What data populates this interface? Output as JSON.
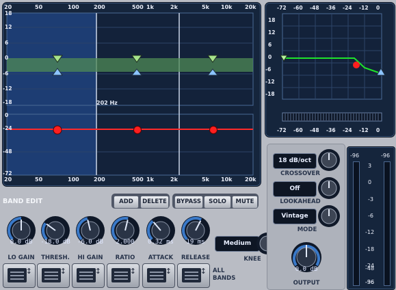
{
  "eq": {
    "freq_ticks": [
      "20",
      "50",
      "100",
      "200",
      "500",
      "1k",
      "2k",
      "5k",
      "10k",
      "20k"
    ],
    "gain_ticks_upper": [
      "18",
      "12",
      "6",
      "0",
      "-6",
      "-12",
      "-18"
    ],
    "gain_ticks_lower": [
      "0",
      "-24",
      "-48",
      "-72"
    ],
    "cursor_freq": "202 Hz"
  },
  "transfer": {
    "ticks_x": [
      "-72",
      "-60",
      "-48",
      "-36",
      "-24",
      "-12",
      "0"
    ],
    "ticks_y": [
      "18",
      "12",
      "6",
      "0",
      "-6",
      "-12",
      "-18"
    ]
  },
  "band_edit": {
    "title": "BAND EDIT",
    "add": "ADD",
    "delete": "DELETE",
    "bypass": "BYPASS",
    "solo": "SOLO",
    "mute": "MUTE"
  },
  "knobs": [
    {
      "label": "LO GAIN",
      "value": "0.0 dB"
    },
    {
      "label": "THRESH.",
      "value": "-18.0 dB"
    },
    {
      "label": "HI GAIN",
      "value": "-6.0 dB"
    },
    {
      "label": "RATIO",
      "value": "2.000"
    },
    {
      "label": "ATTACK",
      "value": "0.32 ms"
    },
    {
      "label": "RELEASE",
      "value": "19 ms"
    }
  ],
  "knee": {
    "label": "KNEE",
    "value": "Medium"
  },
  "all_bands": "ALL BANDS",
  "crossover": {
    "label": "CROSSOVER",
    "value": "18 dB/oct"
  },
  "lookahead": {
    "label": "LOOKAHEAD",
    "value": "Off"
  },
  "mode": {
    "label": "MODE",
    "value": "Vintage"
  },
  "output": {
    "label": "OUTPUT",
    "value": "0.0 dB"
  },
  "meter": {
    "peak_left": "-96",
    "peak_right": "-96",
    "scale": [
      "3",
      "0",
      "-3",
      "-6",
      "-12",
      "-18",
      "-24",
      "-36",
      "-48",
      "-96"
    ]
  }
}
